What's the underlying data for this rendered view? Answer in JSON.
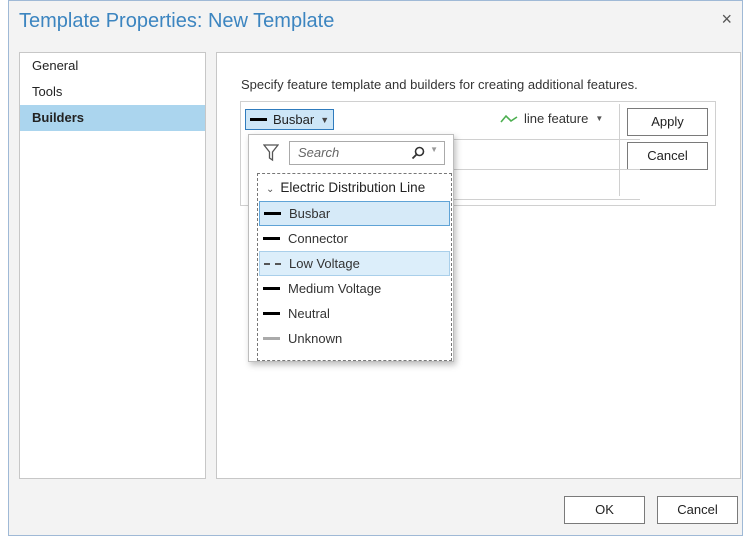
{
  "window": {
    "title": "Template Properties: New Template",
    "close_glyph": "×"
  },
  "nav": {
    "items": [
      {
        "label": "General",
        "active": false
      },
      {
        "label": "Tools",
        "active": false
      },
      {
        "label": "Builders",
        "active": true
      }
    ]
  },
  "builders": {
    "description": "Specify feature template and builders for creating additional features.",
    "selected_template": "Busbar",
    "builder_type": "line feature",
    "apply_label": "Apply",
    "cancel_label": "Cancel"
  },
  "dropdown": {
    "search_placeholder": "Search",
    "group_label": "Electric Distribution Line",
    "items": [
      {
        "label": "Busbar",
        "symbol": "solid-black",
        "state": "selected"
      },
      {
        "label": "Connector",
        "symbol": "solid-black",
        "state": ""
      },
      {
        "label": "Low Voltage",
        "symbol": "dashed",
        "state": "hover"
      },
      {
        "label": "Medium Voltage",
        "symbol": "solid-black",
        "state": ""
      },
      {
        "label": "Neutral",
        "symbol": "solid-black",
        "state": ""
      },
      {
        "label": "Unknown",
        "symbol": "solid-grey",
        "state": ""
      }
    ]
  },
  "footer": {
    "ok_label": "OK",
    "cancel_label": "Cancel"
  },
  "colors": {
    "title": "#3c85c0",
    "nav_active": "#abd5ee",
    "accent_border": "#2f7bbd"
  }
}
